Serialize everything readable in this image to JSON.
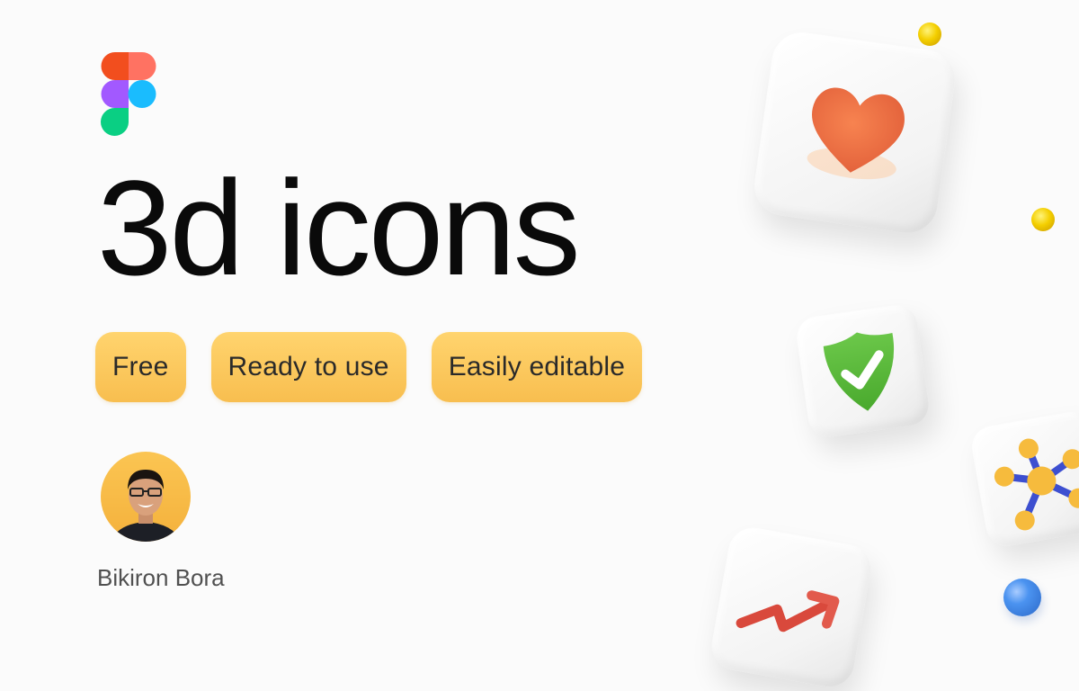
{
  "brand": {
    "logo_icon": "figma-logo-icon"
  },
  "hero": {
    "title": "3d icons"
  },
  "tags": [
    {
      "label": "Free"
    },
    {
      "label": "Ready to use"
    },
    {
      "label": "Easily editable"
    }
  ],
  "author": {
    "name": "Bikiron Bora",
    "avatar_icon": "author-avatar"
  },
  "decor": {
    "icons": [
      "heart-icon",
      "shield-check-icon",
      "network-nodes-icon",
      "trend-up-arrow-icon"
    ],
    "colors": {
      "tag_top": "#ffd46e",
      "tag_bottom": "#f8be4f",
      "heart": "#f07848",
      "shield": "#5cbf3c",
      "arrow": "#d9493c",
      "nodes": "#f6bb3d",
      "links": "#3d4fd0",
      "ball_yellow": "#f4cf00",
      "ball_blue": "#3c86e8"
    }
  }
}
